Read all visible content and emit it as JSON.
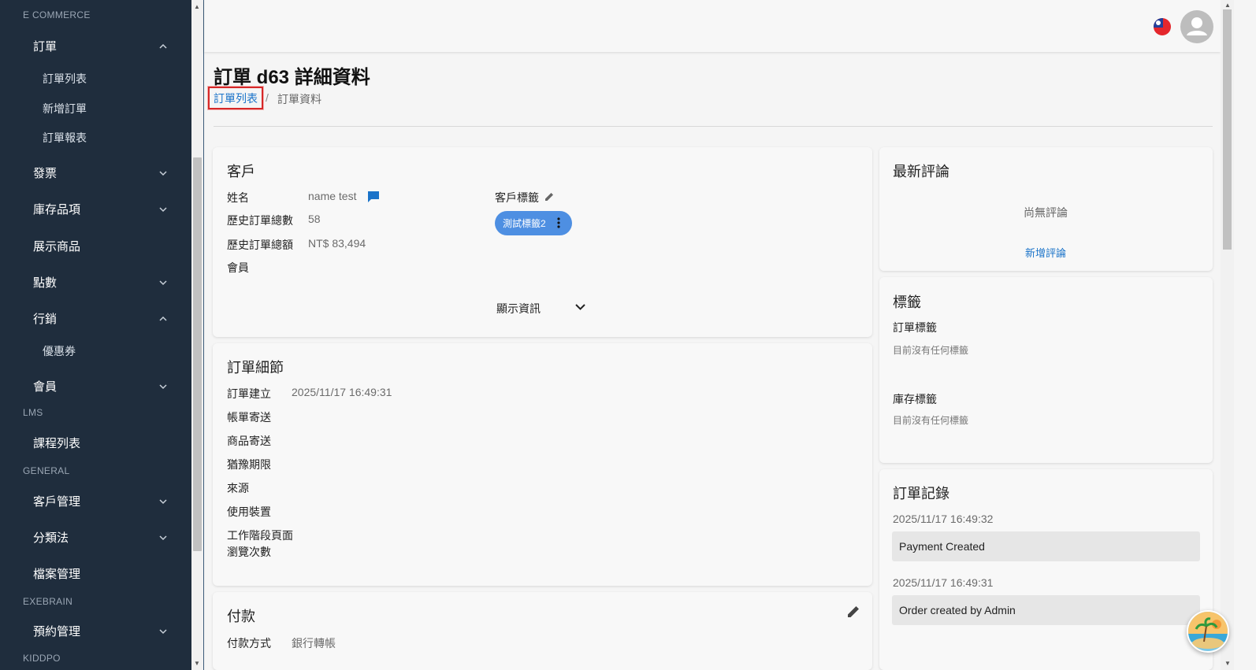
{
  "sidebar": {
    "sections": {
      "ecommerce": "E COMMERCE",
      "lms": "LMS",
      "general": "GENERAL",
      "exebrain": "EXEBRAIN",
      "kiddpo": "KIDDPO"
    },
    "items": {
      "orders": "訂單",
      "order_list": "訂單列表",
      "new_order": "新增訂單",
      "order_report": "訂單報表",
      "invoice": "發票",
      "inventory": "庫存品項",
      "showcase": "展示商品",
      "points": "點數",
      "marketing": "行銷",
      "coupons": "優惠券",
      "members": "會員",
      "courses": "課程列表",
      "customers": "客戶管理",
      "taxonomy": "分類法",
      "files": "檔案管理",
      "booking": "預約管理"
    }
  },
  "header": {
    "title": "訂單 d63 詳細資料",
    "breadcrumb_link": "訂單列表",
    "breadcrumb_sep": "/",
    "breadcrumb_current": "訂單資料"
  },
  "customer": {
    "title": "客戶",
    "name_label": "姓名",
    "name_value": "name test",
    "order_count_label": "歷史訂單總數",
    "order_count_value": "58",
    "order_total_label": "歷史訂單總額",
    "order_total_value": "NT$ 83,494",
    "member_label": "會員",
    "tags_label": "客戶標籤",
    "tag_chip": "測試標籤2",
    "show_info": "顯示資訊"
  },
  "order_details": {
    "title": "訂單細節",
    "created_label": "訂單建立",
    "created_value": "2025/11/17 16:49:31",
    "billing_label": "帳單寄送",
    "shipping_label": "商品寄送",
    "grace_label": "猶豫期限",
    "source_label": "來源",
    "device_label": "使用裝置",
    "pageviews_label_1": "工作階段頁面",
    "pageviews_label_2": "瀏覽次數"
  },
  "payment": {
    "title": "付款",
    "method_label": "付款方式",
    "method_value": "銀行轉帳"
  },
  "reviews": {
    "title": "最新評論",
    "empty": "尚無評論",
    "add": "新增評論"
  },
  "tags": {
    "title": "標籤",
    "order_tags_label": "訂單標籤",
    "order_tags_empty": "目前沒有任何標籤",
    "stock_tags_label": "庫存標籤",
    "stock_tags_empty": "目前沒有任何標籤"
  },
  "order_log": {
    "title": "訂單記錄",
    "entries": [
      {
        "time": "2025/11/17 16:49:32",
        "text": "Payment Created"
      },
      {
        "time": "2025/11/17 16:49:31",
        "text": "Order created by Admin"
      }
    ]
  },
  "colors": {
    "sidebar_bg": "#1f2d3d",
    "accent": "#1a73c9",
    "chip": "#4e8fe2",
    "highlight_border": "#d62828"
  }
}
